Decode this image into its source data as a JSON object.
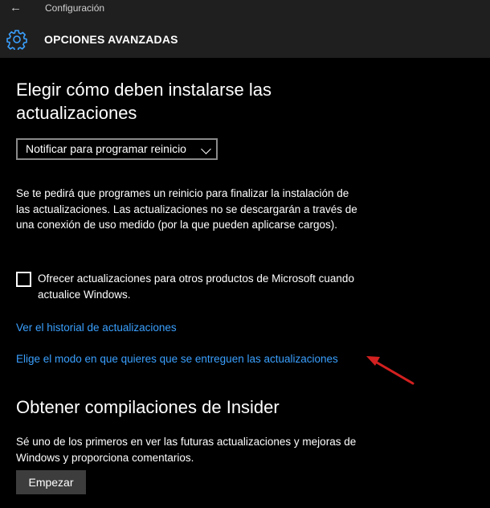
{
  "titlebar": {
    "back_icon": "arrow-left-icon",
    "app_title": "Configuración",
    "page_icon": "gear-icon",
    "page_title": "OPCIONES AVANZADAS"
  },
  "updates": {
    "heading": "Elegir cómo deben instalarse las actualizaciones",
    "dropdown_selected": "Notificar para programar reinicio",
    "description": "Se te pedirá que programes un reinicio para finalizar la instalación de las actualizaciones. Las actualizaciones no se descargarán a través de una conexión de uso medido (por la que pueden aplicarse cargos).",
    "checkbox_label": "Ofrecer actualizaciones para otros productos de Microsoft cuando actualice Windows.",
    "checkbox_checked": false,
    "link_history": "Ver el historial de actualizaciones",
    "link_delivery": "Elige el modo en que quieres que se entreguen las actualizaciones"
  },
  "insider": {
    "heading": "Obtener compilaciones de Insider",
    "description": "Sé uno de los primeros en ver las futuras actualizaciones y mejoras de Windows y proporciona comentarios.",
    "start_button": "Empezar"
  },
  "colors": {
    "background": "#000000",
    "header": "#1f1f1f",
    "accent": "#3aa0ff",
    "annotation_arrow": "#d32020"
  }
}
